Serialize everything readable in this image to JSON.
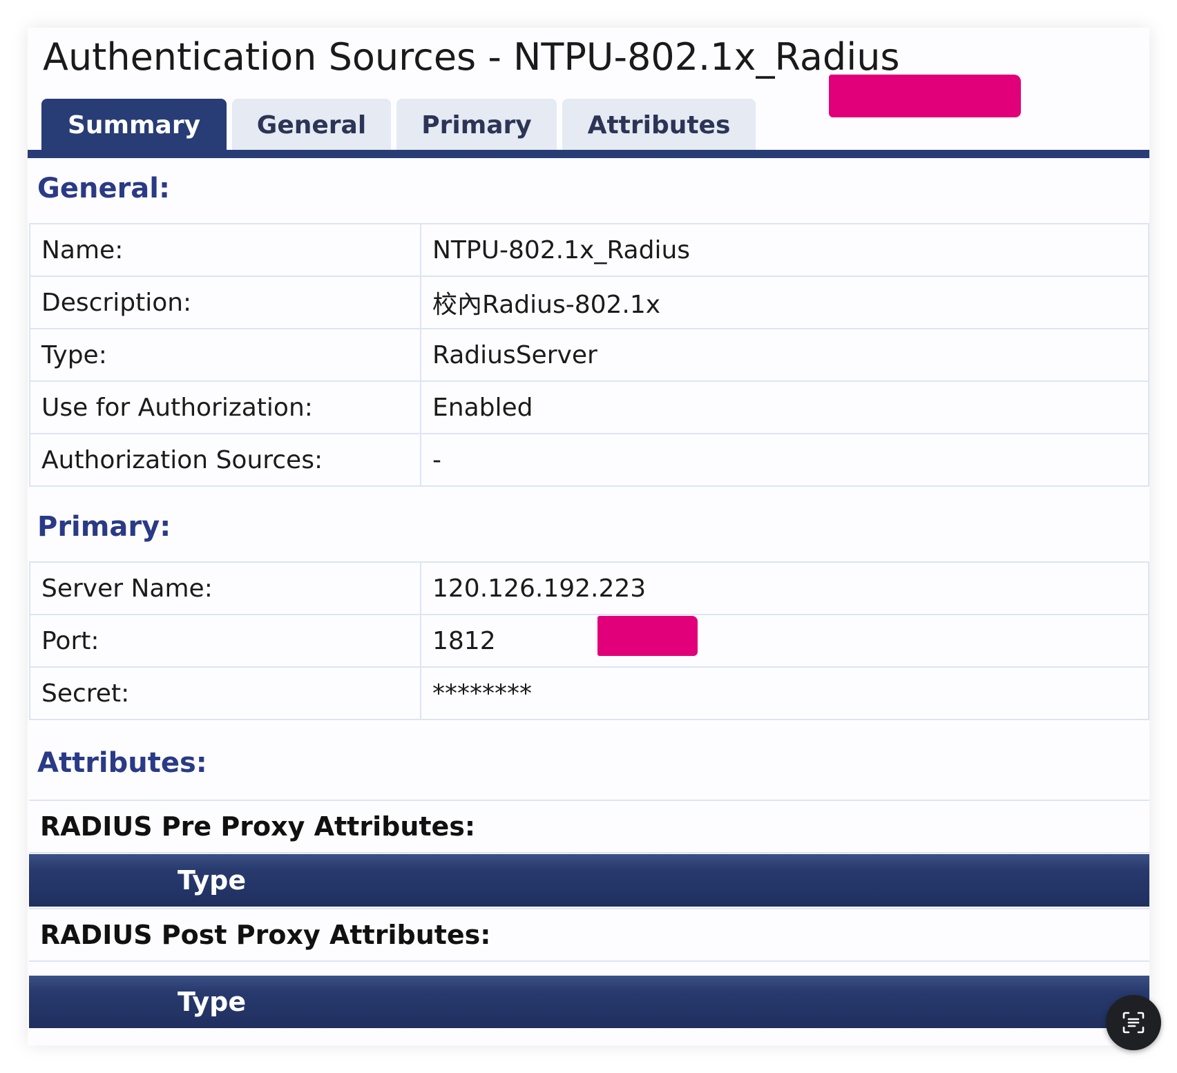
{
  "page": {
    "title": "Authentication Sources - NTPU-802.1x_Radius"
  },
  "tabs": [
    {
      "label": "Summary",
      "active": true
    },
    {
      "label": "General",
      "active": false
    },
    {
      "label": "Primary",
      "active": false
    },
    {
      "label": "Attributes",
      "active": false
    }
  ],
  "sections": {
    "general": {
      "title": "General:",
      "rows": [
        {
          "label": "Name:",
          "value": "NTPU-802.1x_Radius"
        },
        {
          "label": "Description:",
          "value": "校內Radius-802.1x"
        },
        {
          "label": "Type:",
          "value": "RadiusServer"
        },
        {
          "label": "Use for Authorization:",
          "value": "Enabled"
        },
        {
          "label": "Authorization Sources:",
          "value": "-"
        }
      ]
    },
    "primary": {
      "title": "Primary:",
      "rows": [
        {
          "label": "Server Name:",
          "value": "120.126.192.223"
        },
        {
          "label": "Port:",
          "value": "1812"
        },
        {
          "label": "Secret:",
          "value": "********"
        }
      ]
    },
    "attributes": {
      "title": "Attributes:",
      "pre_proxy": {
        "title": "RADIUS Pre Proxy Attributes:",
        "column": "Type"
      },
      "post_proxy": {
        "title": "RADIUS Post Proxy Attributes:",
        "column": "Type"
      }
    }
  },
  "colors": {
    "accent": "#283c75",
    "section_title": "#2a3a86",
    "tab_inactive": "#e5eaf3",
    "redaction": "#e2007a"
  },
  "icons": {
    "floating_button": "scan-text-icon"
  }
}
